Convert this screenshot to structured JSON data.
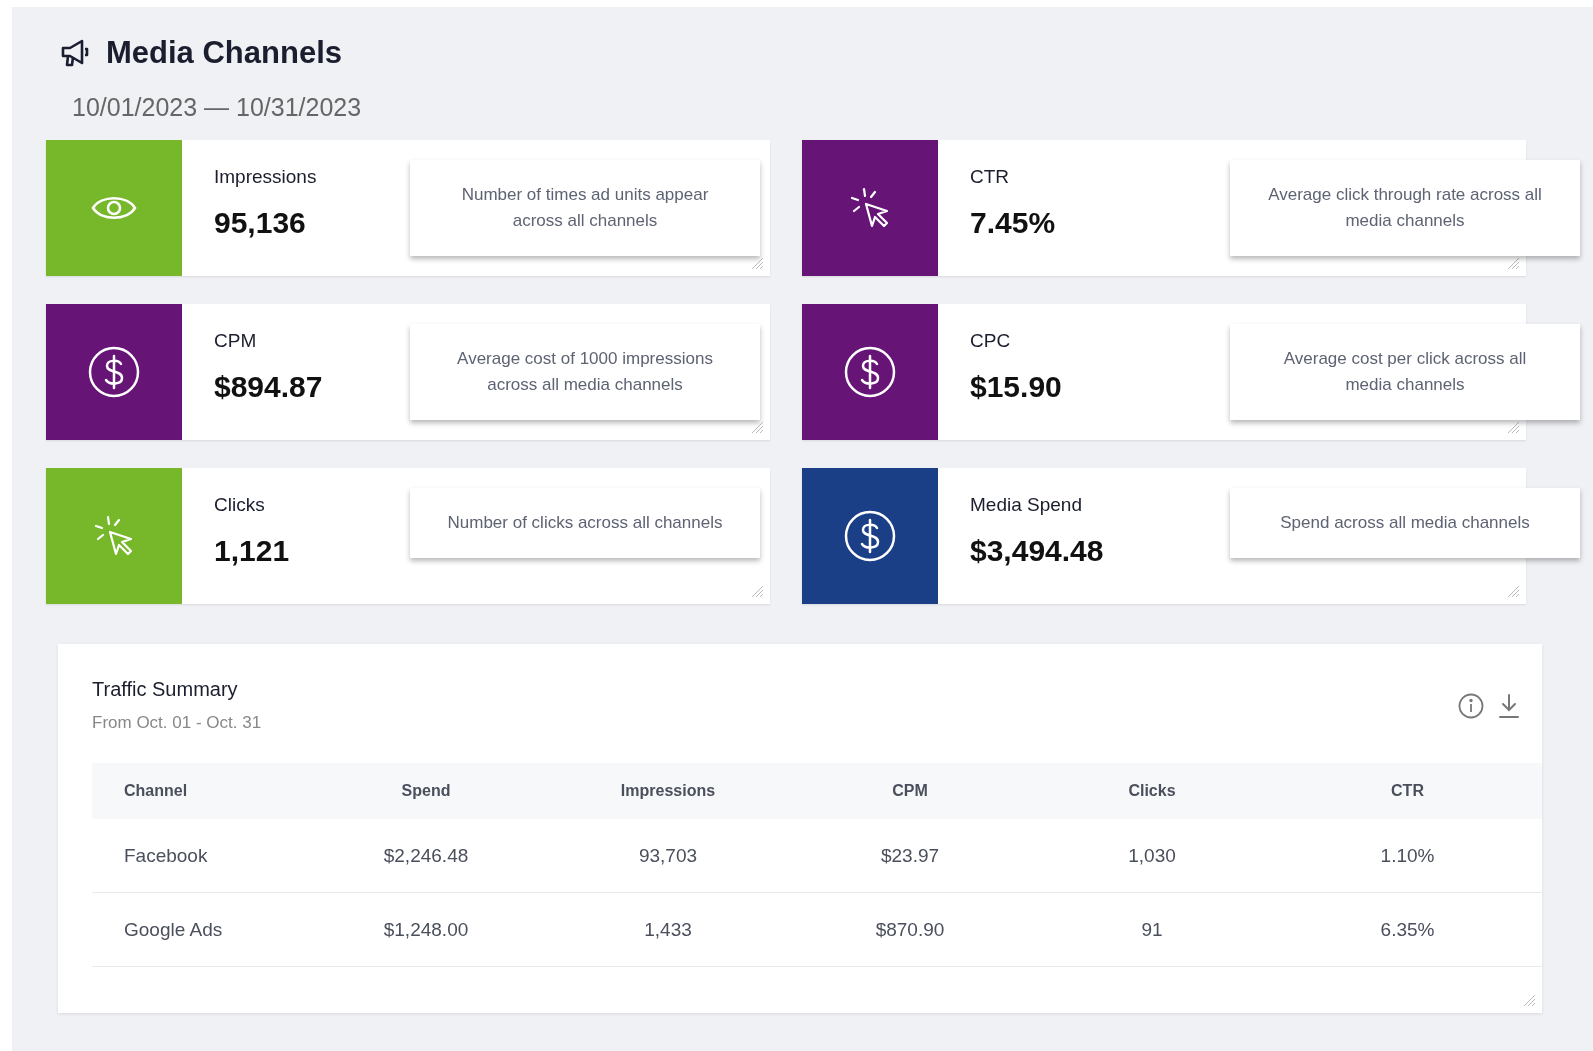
{
  "header": {
    "title": "Media Channels",
    "date_range": "10/01/2023 — 10/31/2023"
  },
  "metrics": [
    {
      "label": "Impressions",
      "value": "95,136",
      "description": "Number of times ad units appear across all channels",
      "color": "#76b82a",
      "kind": "eye"
    },
    {
      "label": "CTR",
      "value": "7.45%",
      "description": "Average click through rate across all media channels",
      "color": "#661577",
      "kind": "cursor"
    },
    {
      "label": "CPM",
      "value": "$894.87",
      "description": "Average cost of 1000 impressions across all media channels",
      "color": "#661577",
      "kind": "dollar"
    },
    {
      "label": "CPC",
      "value": "$15.90",
      "description": "Average cost per click across all media channels",
      "color": "#661577",
      "kind": "dollar"
    },
    {
      "label": "Clicks",
      "value": "1,121",
      "description": "Number of clicks across all channels",
      "color": "#76b82a",
      "kind": "cursor"
    },
    {
      "label": "Media Spend",
      "value": "$3,494.48",
      "description": "Spend across all media channels",
      "color": "#1b3f87",
      "kind": "dollar"
    }
  ],
  "traffic_summary": {
    "title": "Traffic Summary",
    "subtitle": "From Oct. 01 - Oct. 31",
    "columns": [
      "Channel",
      "Spend",
      "Impressions",
      "CPM",
      "Clicks",
      "CTR"
    ],
    "rows": [
      [
        "Facebook",
        "$2,246.48",
        "93,703",
        "$23.97",
        "1,030",
        "1.10%"
      ],
      [
        "Google Ads",
        "$1,248.00",
        "1,433",
        "$870.90",
        "91",
        "6.35%"
      ]
    ]
  }
}
